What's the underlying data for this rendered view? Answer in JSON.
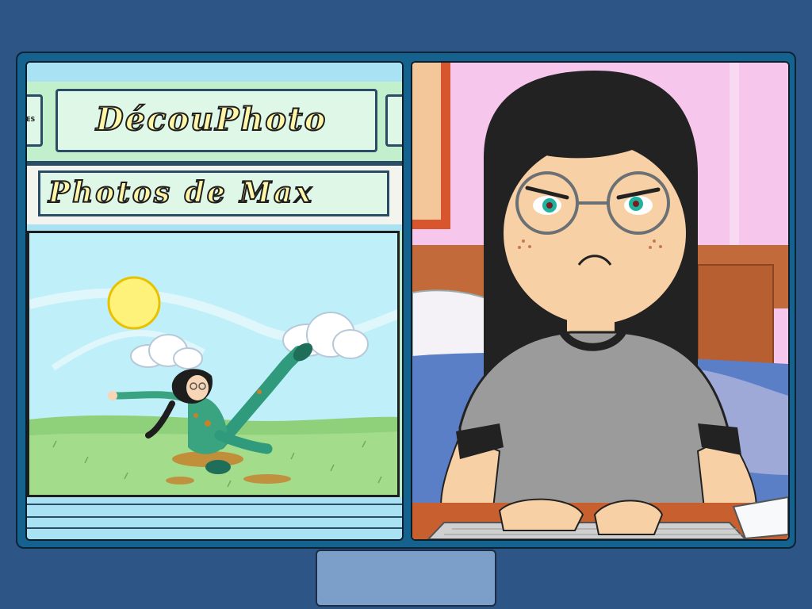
{
  "browser": {
    "site_title": "DécouPhoto",
    "left_tab_fragment": "ES",
    "right_tab_fragment": "",
    "page_heading": "Photos de Max"
  },
  "photo": {
    "icon": "kicking-girl-photo"
  },
  "scene": {
    "character": "girl-with-glasses-typing"
  },
  "colors": {
    "background": "#2d5585",
    "frame": "#15628f",
    "title_fill": "#fff6a8",
    "tab_fill": "#dff7e7"
  }
}
